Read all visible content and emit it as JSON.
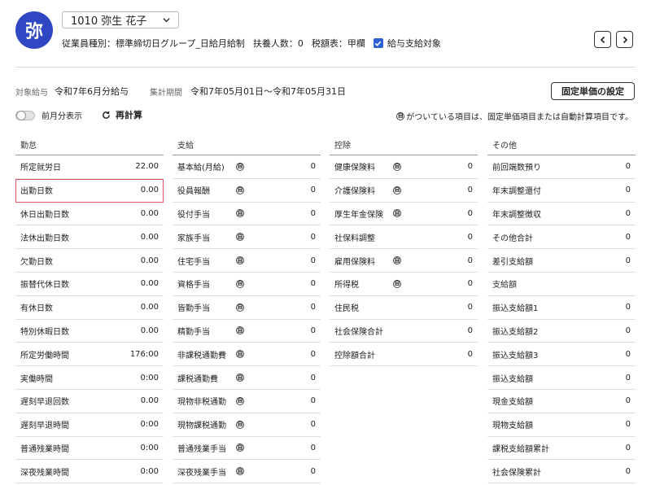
{
  "header": {
    "avatar_char": "弥",
    "employee": "1010 弥生 花子",
    "type_label": "従業員種別：標準締切日グループ_日給月給制",
    "dependents_label": "扶養人数：0",
    "tax_table_label": "税額表：甲欄",
    "payroll_target_label": "給与支給対象",
    "payroll_target_checked": true
  },
  "period": {
    "target_label": "対象給与",
    "target_value": "令和7年6月分給与",
    "agg_label": "集計期間",
    "agg_value": "令和7年05月01日〜令和7年05月31日"
  },
  "toolbar": {
    "fixed_price_button": "固定単価の設定",
    "prev_month_label": "前月分表示",
    "recalc_label": "再計算",
    "note": "がついている項目は、固定単価項目または自動計算項目です。",
    "badge_char": "自"
  },
  "columns": [
    {
      "title": "勤怠",
      "rows": [
        {
          "name": "所定就労日",
          "value": "22.00",
          "badge": false
        },
        {
          "name": "出勤日数",
          "value": "0.00",
          "badge": false,
          "highlight": true
        },
        {
          "name": "休日出勤日数",
          "value": "0.00",
          "badge": false
        },
        {
          "name": "法休出勤日数",
          "value": "0.00",
          "badge": false
        },
        {
          "name": "欠勤日数",
          "value": "0.00",
          "badge": false
        },
        {
          "name": "振替代休日数",
          "value": "0.00",
          "badge": false
        },
        {
          "name": "有休日数",
          "value": "0.00",
          "badge": false
        },
        {
          "name": "特別休暇日数",
          "value": "0.00",
          "badge": false
        },
        {
          "name": "所定労働時間",
          "value": "176:00",
          "badge": false
        },
        {
          "name": "実働時間",
          "value": "0:00",
          "badge": false
        },
        {
          "name": "遅刻早退回数",
          "value": "0.00",
          "badge": false
        },
        {
          "name": "遅刻早退時間",
          "value": "0:00",
          "badge": false
        },
        {
          "name": "普通残業時間",
          "value": "0:00",
          "badge": false
        },
        {
          "name": "深夜残業時間",
          "value": "0:00",
          "badge": false
        }
      ]
    },
    {
      "title": "支給",
      "rows": [
        {
          "name": "基本給(月給)",
          "value": "0",
          "badge": true
        },
        {
          "name": "役員報酬",
          "value": "0",
          "badge": true
        },
        {
          "name": "役付手当",
          "value": "0",
          "badge": true
        },
        {
          "name": "家族手当",
          "value": "0",
          "badge": true
        },
        {
          "name": "住宅手当",
          "value": "0",
          "badge": true
        },
        {
          "name": "資格手当",
          "value": "0",
          "badge": true
        },
        {
          "name": "皆勤手当",
          "value": "0",
          "badge": true
        },
        {
          "name": "精勤手当",
          "value": "0",
          "badge": true
        },
        {
          "name": "非課税通勤費",
          "value": "0",
          "badge": true
        },
        {
          "name": "課税通勤費",
          "value": "0",
          "badge": true
        },
        {
          "name": "現物非税通勤",
          "value": "0",
          "badge": true
        },
        {
          "name": "現物課税通勤",
          "value": "0",
          "badge": true
        },
        {
          "name": "普通残業手当",
          "value": "0",
          "badge": true
        },
        {
          "name": "深夜残業手当",
          "value": "0",
          "badge": true
        }
      ]
    },
    {
      "title": "控除",
      "rows": [
        {
          "name": "健康保険料",
          "value": "0",
          "badge": true
        },
        {
          "name": "介護保険料",
          "value": "0",
          "badge": true
        },
        {
          "name": "厚生年金保険",
          "value": "0",
          "badge": true
        },
        {
          "name": "社保料調整",
          "value": "0",
          "badge": false
        },
        {
          "name": "雇用保険料",
          "value": "0",
          "badge": true
        },
        {
          "name": "所得税",
          "value": "0",
          "badge": true
        },
        {
          "name": "住民税",
          "value": "0",
          "badge": false
        },
        {
          "name": "社会保険合計",
          "value": "0",
          "badge": false
        },
        {
          "name": "控除額合計",
          "value": "0",
          "badge": false
        }
      ]
    },
    {
      "title": "その他",
      "rows": [
        {
          "name": "前回端数預り",
          "value": "0",
          "badge": false
        },
        {
          "name": "年末調整還付",
          "value": "0",
          "badge": false
        },
        {
          "name": "年末調整徴収",
          "value": "0",
          "badge": false
        },
        {
          "name": "その他合計",
          "value": "0",
          "badge": false
        },
        {
          "name": "差引支給額",
          "value": "0",
          "badge": false
        },
        {
          "name": "支給額",
          "value": "",
          "badge": false,
          "subheader": true
        },
        {
          "name": "振込支給額1",
          "value": "0",
          "badge": false
        },
        {
          "name": "振込支給額2",
          "value": "0",
          "badge": false
        },
        {
          "name": "振込支給額3",
          "value": "0",
          "badge": false
        },
        {
          "name": "振込支給額",
          "value": "0",
          "badge": false
        },
        {
          "name": "現金支給額",
          "value": "0",
          "badge": false
        },
        {
          "name": "現物支給額",
          "value": "0",
          "badge": false
        },
        {
          "name": "課税支給額累計",
          "value": "0",
          "badge": false
        },
        {
          "name": "社会保険累計",
          "value": "0",
          "badge": false
        }
      ]
    }
  ],
  "colors": {
    "accent": "#2f47c2",
    "checkbox": "#2f5fd6",
    "highlight": "#e0556a"
  }
}
